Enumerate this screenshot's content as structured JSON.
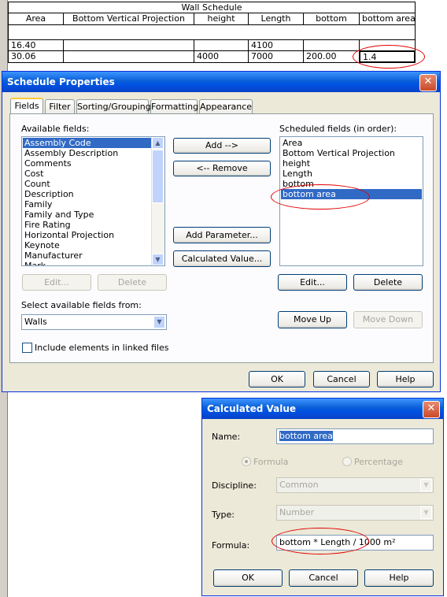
{
  "schedule": {
    "title": "Wall Schedule",
    "headers": [
      "Area",
      "Bottom Vertical Projection",
      "height",
      "Length",
      "bottom",
      "bottom area"
    ],
    "rows": [
      [
        "16.40",
        "",
        "",
        "4100",
        "",
        ""
      ],
      [
        "30.06",
        "",
        "4000",
        "7000",
        "200.00",
        "1.4"
      ]
    ]
  },
  "schedule_properties": {
    "title": "Schedule Properties",
    "tabs": [
      "Fields",
      "Filter",
      "Sorting/Grouping",
      "Formatting",
      "Appearance"
    ],
    "active_tab": "Fields",
    "available_label": "Available fields:",
    "available_fields": [
      "Assembly Code",
      "Assembly Description",
      "Comments",
      "Cost",
      "Count",
      "Description",
      "Family",
      "Family and Type",
      "Fire Rating",
      "Horizontal Projection",
      "Keynote",
      "Manufacturer",
      "Mark"
    ],
    "available_selected_index": 0,
    "scheduled_label": "Scheduled fields (in order):",
    "scheduled_fields": [
      "Area",
      "Bottom Vertical Projection",
      "height",
      "Length",
      "bottom",
      "bottom area"
    ],
    "scheduled_selected_index": 5,
    "buttons": {
      "add": "Add -->",
      "remove": "<-- Remove",
      "add_parameter": "Add Parameter...",
      "calculated_value": "Calculated Value...",
      "edit_left": "Edit...",
      "delete_left": "Delete",
      "edit_right": "Edit...",
      "delete_right": "Delete",
      "move_up": "Move Up",
      "move_down": "Move Down",
      "ok": "OK",
      "cancel": "Cancel",
      "help": "Help"
    },
    "select_from_label": "Select available fields from:",
    "select_from_value": "Walls",
    "include_linked_label": "Include elements in linked files",
    "include_linked_checked": false
  },
  "calculated_value": {
    "title": "Calculated Value",
    "name_label": "Name:",
    "name_value": "bottom area",
    "formula_radio": "Formula",
    "percentage_radio": "Percentage",
    "discipline_label": "Discipline:",
    "discipline_value": "Common",
    "type_label": "Type:",
    "type_value": "Number",
    "formula_label": "Formula:",
    "formula_value": "bottom * Length / 1000 m²",
    "buttons": {
      "ok": "OK",
      "cancel": "Cancel",
      "help": "Help"
    }
  },
  "colors": {
    "title_blue": "#0054e3",
    "selection": "#316ac5",
    "annotation": "#e00000",
    "dialog_bg": "#ece9d8"
  }
}
